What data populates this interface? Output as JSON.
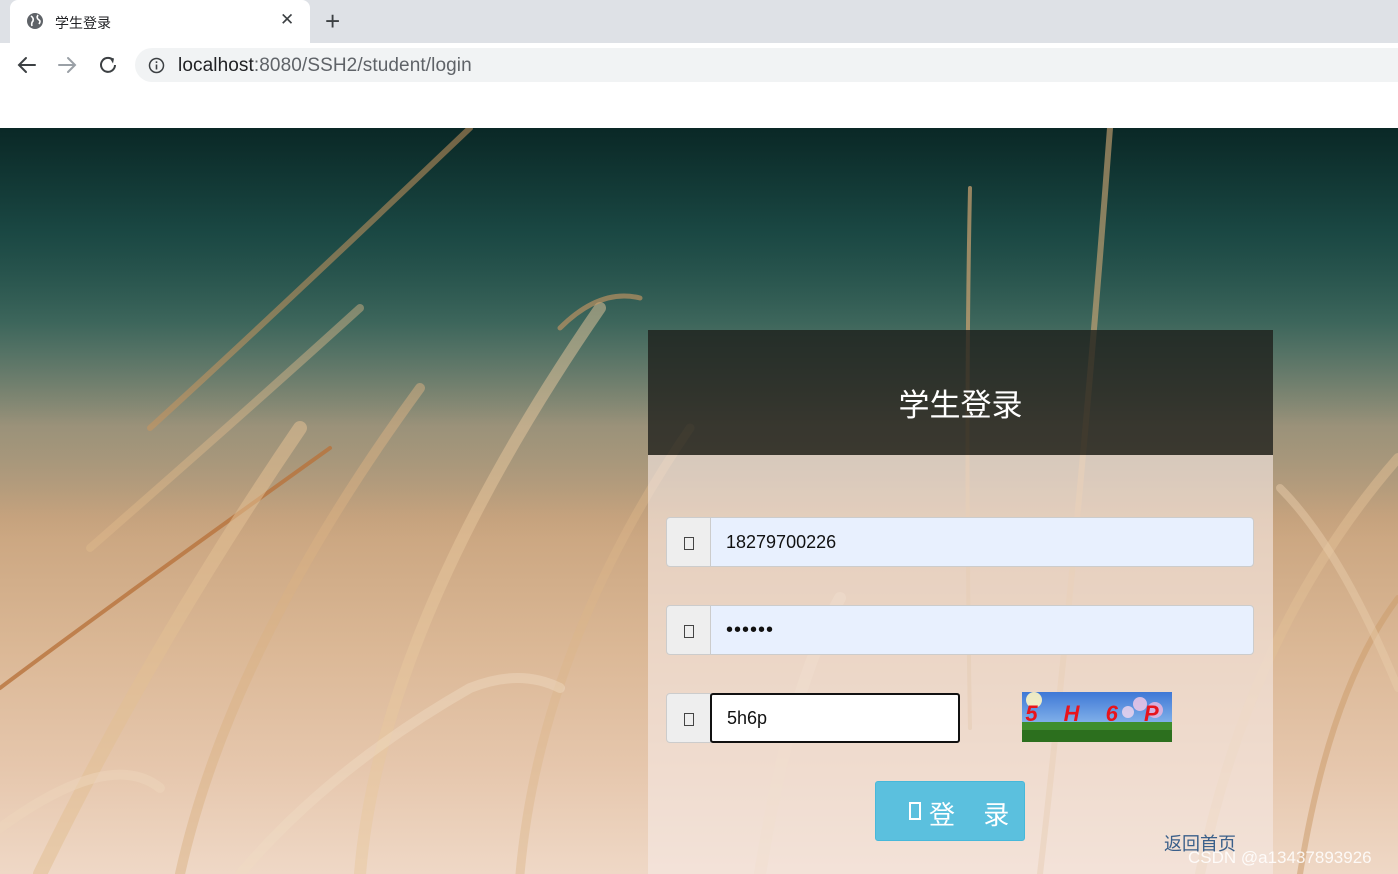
{
  "browser": {
    "tab_title": "学生登录",
    "tab_close": "✕",
    "new_tab": "+",
    "url_host": "localhost",
    "url_rest": ":8080/SSH2/student/login"
  },
  "login": {
    "title": "学生登录",
    "username_value": "18279700226",
    "password_value": "••••••",
    "captcha_value": "5h6p",
    "captcha_text": "5 H 6 P",
    "submit_label": "登 录"
  },
  "footer": {
    "home_link": "返回首页",
    "watermark": "CSDN @a13437893926"
  },
  "icons": {
    "tab": "globe-icon",
    "back": "arrow-left-icon",
    "forward": "arrow-right-icon",
    "reload": "reload-icon",
    "site_info": "info-icon",
    "username": "user-icon",
    "password": "lock-icon",
    "captcha": "key-icon",
    "submit": "login-icon"
  },
  "colors": {
    "button": "#5bc0de",
    "captcha_text": "#e8141c",
    "autofill": "#e8f0fe",
    "link": "#3a5f8a"
  }
}
